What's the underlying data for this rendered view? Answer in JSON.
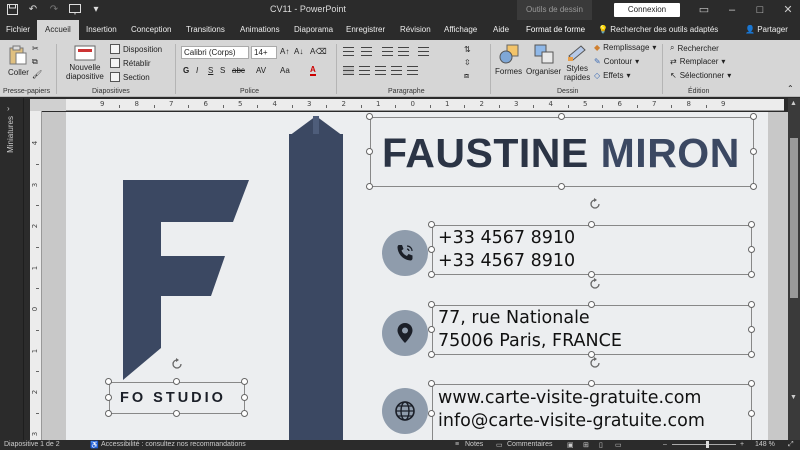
{
  "window": {
    "title": "CV11 - PowerPoint",
    "contextual_group": "Outils de dessin",
    "signin_button": "Connexion"
  },
  "tabs": [
    {
      "label": "Fichier"
    },
    {
      "label": "Accueil",
      "active": true
    },
    {
      "label": "Insertion"
    },
    {
      "label": "Conception"
    },
    {
      "label": "Transitions"
    },
    {
      "label": "Animations"
    },
    {
      "label": "Diaporama"
    },
    {
      "label": "Enregistrer"
    },
    {
      "label": "Révision"
    },
    {
      "label": "Affichage"
    },
    {
      "label": "Aide"
    },
    {
      "label": "Format de forme"
    }
  ],
  "tell_me": "Rechercher des outils adaptés",
  "share": "Partager",
  "ribbon": {
    "clipboard": {
      "paste": "Coller",
      "label": "Presse-papiers"
    },
    "slides": {
      "new_slide_1": "Nouvelle",
      "new_slide_2": "diapositive",
      "layout": "Disposition",
      "reset": "Rétablir",
      "section": "Section",
      "label": "Diapositives"
    },
    "font": {
      "name": "Calibri (Corps)",
      "size": "14+",
      "label": "Police",
      "bold": "G",
      "italic": "I",
      "underline": "S",
      "strike": "S",
      "abc": "abc",
      "av": "AV",
      "aa": "Aa",
      "a": "A"
    },
    "paragraph": {
      "label": "Paragraphe"
    },
    "drawing": {
      "shapes": "Formes",
      "arrange": "Organiser",
      "styles_1": "Styles",
      "styles_2": "rapides",
      "fill": "Remplissage",
      "outline": "Contour",
      "effects": "Effets",
      "label": "Dessin"
    },
    "editing": {
      "find": "Rechercher",
      "replace": "Remplacer",
      "select": "Sélectionner",
      "label": "Édition"
    }
  },
  "left_pane": {
    "label": "Miniatures"
  },
  "ruler": {
    "h_ticks": [
      "9",
      "8",
      "7",
      "6",
      "5",
      "4",
      "3",
      "2",
      "1",
      "0",
      "1",
      "2",
      "3",
      "4",
      "5",
      "6",
      "7",
      "8",
      "9"
    ],
    "v_ticks": [
      "4",
      "3",
      "2",
      "1",
      "0",
      "1",
      "2",
      "3"
    ]
  },
  "slide": {
    "name_first": "FAUSTINE",
    "name_last": "MIRON",
    "studio": "FO STUDIO",
    "phone_1": "+33 4567 8910",
    "phone_2": "+33 4567 8910",
    "address_1": "77, rue Nationale",
    "address_2": "75006 Paris, FRANCE",
    "web": "www.carte-visite-gratuite.com",
    "email": "info@carte-visite-gratuite.com",
    "name_color": "#2b3445",
    "accent_color": "#3b4862",
    "icon_circle_color": "#8f9cac"
  },
  "status": {
    "slide": "Diapositive 1 de 2",
    "accessibility": "Accessibilité : consultez nos recommandations",
    "notes": "Notes",
    "comments": "Commentaires",
    "zoom": "148 %"
  }
}
